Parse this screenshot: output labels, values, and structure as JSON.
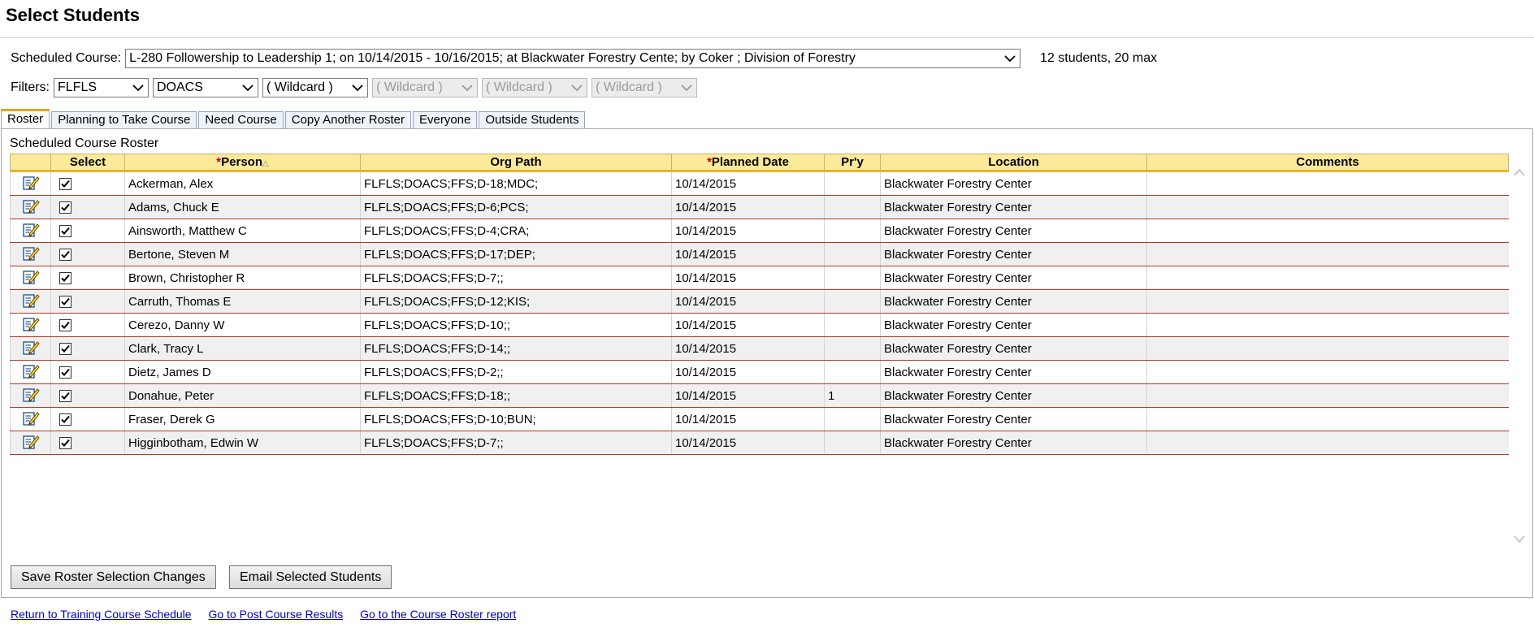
{
  "page": {
    "title": "Select Students"
  },
  "course": {
    "label": "Scheduled Course:",
    "selected": "L-280 Followership to Leadership 1; on 10/14/2015 - 10/16/2015; at Blackwater Forestry Cente; by Coker ; Division of Forestry",
    "count_text": "12 students, 20 max"
  },
  "filters": {
    "label": "Filters:",
    "values": [
      "FLFLS",
      "DOACS",
      "( Wildcard )",
      "( Wildcard )",
      "( Wildcard )",
      "( Wildcard )"
    ]
  },
  "tabs": [
    "Roster",
    "Planning to Take Course",
    "Need Course",
    "Copy Another Roster",
    "Everyone",
    "Outside Students"
  ],
  "roster": {
    "title": "Scheduled Course Roster",
    "columns": {
      "select": "Select",
      "person": "Person",
      "org_path": "Org Path",
      "planned_date": "Planned Date",
      "priority": "Pr'y",
      "location": "Location",
      "comments": "Comments"
    },
    "rows": [
      {
        "person": "Ackerman, Alex",
        "org_path": "FLFLS;DOACS;FFS;D-18;MDC;",
        "date": "10/14/2015",
        "priority": "",
        "location": "Blackwater Forestry Center",
        "comments": ""
      },
      {
        "person": "Adams, Chuck E",
        "org_path": "FLFLS;DOACS;FFS;D-6;PCS;",
        "date": "10/14/2015",
        "priority": "",
        "location": "Blackwater Forestry Center",
        "comments": ""
      },
      {
        "person": "Ainsworth, Matthew C",
        "org_path": "FLFLS;DOACS;FFS;D-4;CRA;",
        "date": "10/14/2015",
        "priority": "",
        "location": "Blackwater Forestry Center",
        "comments": ""
      },
      {
        "person": "Bertone, Steven M",
        "org_path": "FLFLS;DOACS;FFS;D-17;DEP;",
        "date": "10/14/2015",
        "priority": "",
        "location": "Blackwater Forestry Center",
        "comments": ""
      },
      {
        "person": "Brown, Christopher R",
        "org_path": "FLFLS;DOACS;FFS;D-7;;",
        "date": "10/14/2015",
        "priority": "",
        "location": "Blackwater Forestry Center",
        "comments": ""
      },
      {
        "person": "Carruth, Thomas E",
        "org_path": "FLFLS;DOACS;FFS;D-12;KIS;",
        "date": "10/14/2015",
        "priority": "",
        "location": "Blackwater Forestry Center",
        "comments": ""
      },
      {
        "person": "Cerezo, Danny W",
        "org_path": "FLFLS;DOACS;FFS;D-10;;",
        "date": "10/14/2015",
        "priority": "",
        "location": "Blackwater Forestry Center",
        "comments": ""
      },
      {
        "person": "Clark, Tracy L",
        "org_path": "FLFLS;DOACS;FFS;D-14;;",
        "date": "10/14/2015",
        "priority": "",
        "location": "Blackwater Forestry Center",
        "comments": ""
      },
      {
        "person": "Dietz, James D",
        "org_path": "FLFLS;DOACS;FFS;D-2;;",
        "date": "10/14/2015",
        "priority": "",
        "location": "Blackwater Forestry Center",
        "comments": ""
      },
      {
        "person": "Donahue, Peter",
        "org_path": "FLFLS;DOACS;FFS;D-18;;",
        "date": "10/14/2015",
        "priority": "1",
        "location": "Blackwater Forestry Center",
        "comments": ""
      },
      {
        "person": "Fraser, Derek G",
        "org_path": "FLFLS;DOACS;FFS;D-10;BUN;",
        "date": "10/14/2015",
        "priority": "",
        "location": "Blackwater Forestry Center",
        "comments": ""
      },
      {
        "person": "Higginbotham, Edwin W",
        "org_path": "FLFLS;DOACS;FFS;D-7;;",
        "date": "10/14/2015",
        "priority": "",
        "location": "Blackwater Forestry Center",
        "comments": ""
      }
    ]
  },
  "buttons": {
    "save": "Save Roster Selection Changes",
    "email": "Email Selected Students"
  },
  "links": [
    "Return to Training Course Schedule",
    "Go to Post Course Results",
    "Go to the Course Roster report"
  ]
}
